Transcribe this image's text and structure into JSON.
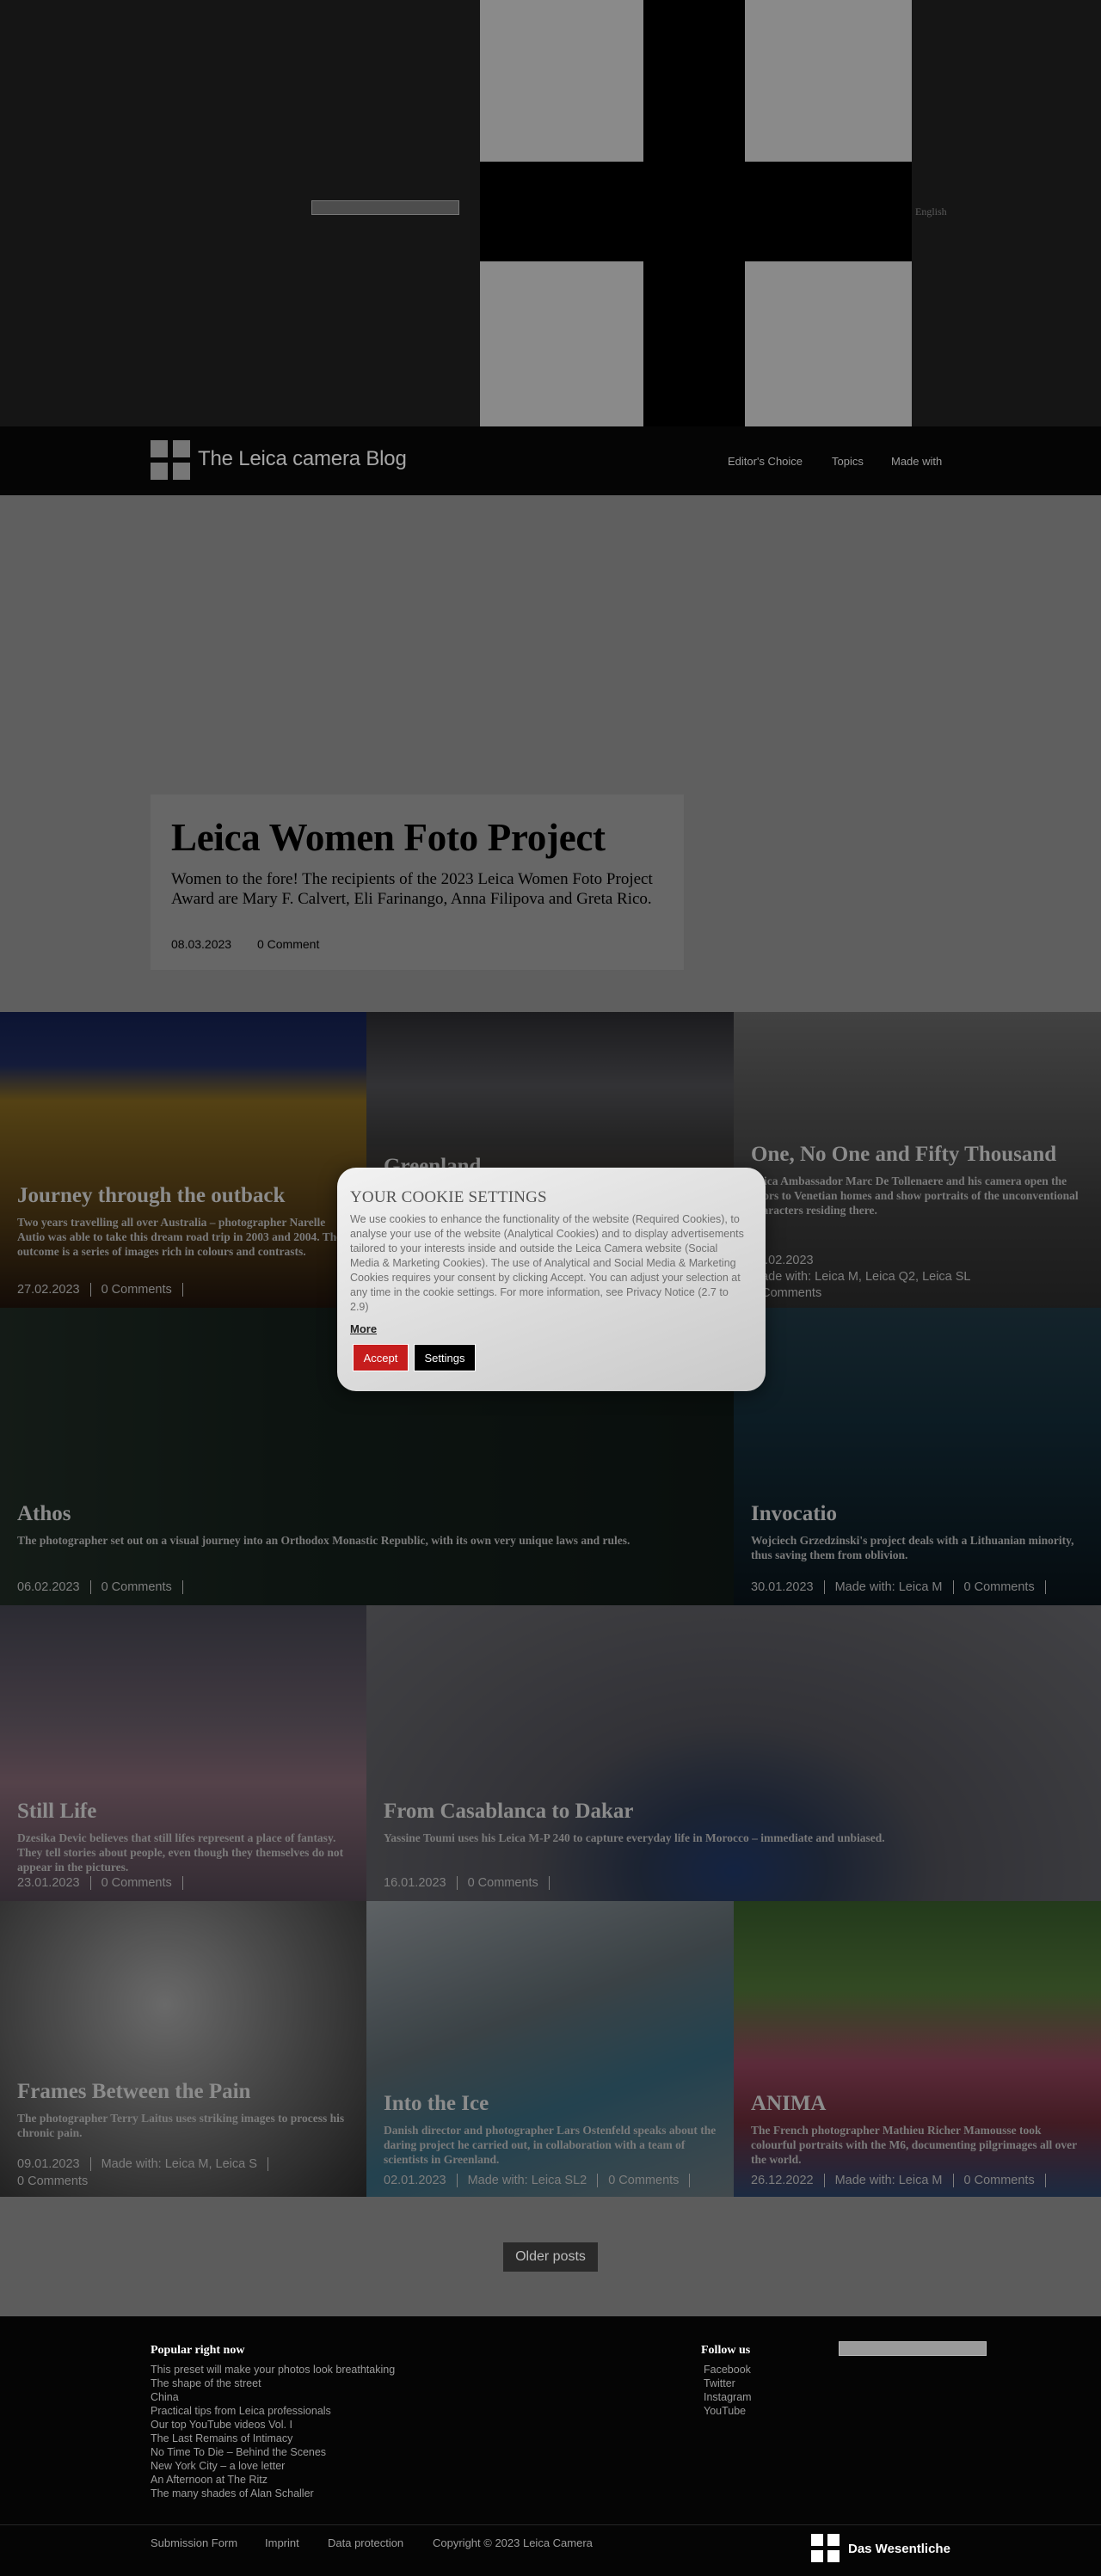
{
  "top": {
    "language_label": "English"
  },
  "header": {
    "site_title": "The Leica camera Blog",
    "nav": [
      "Editor's Choice",
      "Topics",
      "Made with"
    ]
  },
  "hero": {
    "title": "Leica Women Foto Project",
    "text": "Women to the fore! The recipients of the 2023 Leica Women Foto Project Award are Mary F. Calvert, Eli Farinango, Anna Filipova and Greta Rico.",
    "date": "08.03.2023",
    "comments": "0 Comment"
  },
  "posts": [
    {
      "title": "Journey through the outback",
      "text": "Two years travelling all over Australia – photographer Narelle Autio was able to take this dream road trip in 2003 and 2004. The outcome is a series of images rich in colours and contrasts.",
      "meta": [
        "27.02.2023",
        "0 Comments"
      ]
    },
    {
      "title": "Greenland",
      "text": "",
      "meta": []
    },
    {
      "title": "One, No One and Fifty Thousand",
      "text": "Leica Ambassador Marc De Tollenaere and his camera open the doors to Venetian homes and show portraits of the unconventional characters residing there.",
      "meta": [
        "20.02.2023",
        "Made with: Leica M, Leica Q2, Leica SL",
        "0 Comments"
      ]
    },
    {
      "title": "Athos",
      "text": "The photographer set out on a visual journey into an Orthodox Monastic Republic, with its own very unique laws and rules.",
      "meta": [
        "06.02.2023",
        "0 Comments"
      ]
    },
    {
      "title": "Invocatio",
      "text": "Wojciech Grzedzinski's project deals with a Lithuanian minority, thus saving them from oblivion.",
      "meta": [
        "30.01.2023",
        "Made with: Leica M",
        "0 Comments"
      ]
    },
    {
      "title": "Still Life",
      "text": "Dzesika Devic believes that still lifes represent a place of fantasy. They tell stories about people, even though they themselves do not appear in the pictures.",
      "meta": [
        "23.01.2023",
        "0 Comments"
      ]
    },
    {
      "title": "From Casablanca to Dakar",
      "text": "Yassine Toumi uses his Leica M-P 240 to capture everyday life in Morocco – immediate and unbiased.",
      "meta": [
        "16.01.2023",
        "0 Comments"
      ]
    },
    {
      "title": "Frames Between the Pain",
      "text": "The photographer Terry Laitus uses striking images to process his chronic pain.",
      "meta": [
        "09.01.2023",
        "Made with: Leica M, Leica S",
        "0 Comments"
      ]
    },
    {
      "title": "Into the Ice",
      "text": "Danish director and photographer Lars Ostenfeld speaks about the daring project he carried out, in collaboration with a team of scientists in Greenland.",
      "meta": [
        "02.01.2023",
        "Made with: Leica SL2",
        "0 Comments"
      ]
    },
    {
      "title": "ANIMA",
      "text": "The French photographer Mathieu Richer Mamousse took colourful portraits with the M6, documenting pilgrimages all over the world.",
      "meta": [
        "26.12.2022",
        "Made with: Leica M",
        "0 Comments"
      ]
    }
  ],
  "older_posts_label": "Older posts",
  "cookie": {
    "title": "YOUR COOKIE SETTINGS",
    "text": "We use cookies to enhance the functionality of the website (Required Cookies), to analyse your use of the website (Analytical Cookies) and to display advertisements tailored to your interests inside and outside the Leica Camera website (Social Media & Marketing Cookies). The use of Analytical and Social Media & Marketing Cookies requires your consent by clicking Accept. You can adjust your selection at any time in the cookie settings. For more information, see Privacy Notice (2.7 to 2.9)",
    "more": "More",
    "accept": "Accept",
    "settings": "Settings",
    "accept_color": "#c61d1d"
  },
  "footer": {
    "popular_heading": "Popular right now",
    "popular": [
      "This preset will make your photos look breathtaking",
      "The shape of the street",
      "China",
      "Practical tips from Leica professionals",
      "Our top YouTube videos Vol. I",
      "The Last Remains of Intimacy",
      "No Time To Die – Behind the Scenes",
      "New York City – a love letter",
      "An Afternoon at The Ritz",
      "The many shades of Alan Schaller"
    ],
    "follow_heading": "Follow us",
    "follow": [
      "Facebook",
      "Twitter",
      "Instagram",
      "YouTube"
    ],
    "links": [
      "Submission Form",
      "Imprint",
      "Data protection",
      "Copyright © 2023 Leica Camera"
    ],
    "brand": "Das Wesentliche"
  }
}
